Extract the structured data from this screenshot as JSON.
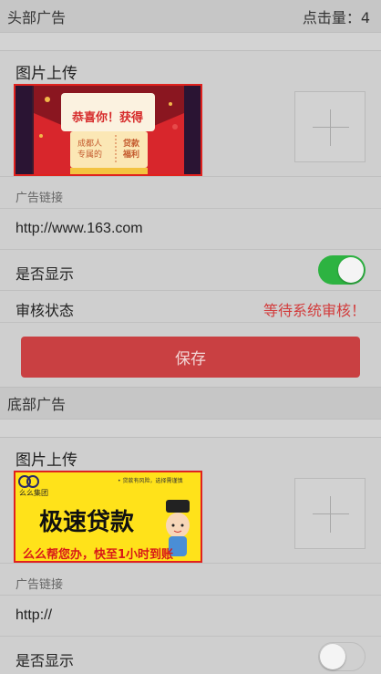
{
  "top_section": {
    "title": "头部广告",
    "clicks_label": "点击量：4",
    "upload_title": "图片上传",
    "image": {
      "headline": "恭喜你！获得",
      "left_text": "成都人\n专属的",
      "right_text": "贷款\n福利"
    },
    "link_label": "广告链接",
    "link_value": "http://www.163.com",
    "show_label": "是否显示",
    "show_enabled": true,
    "review_label": "审核状态",
    "review_status": "等待系统审核！",
    "save_label": "保存"
  },
  "bottom_section": {
    "title": "底部广告",
    "upload_title": "图片上传",
    "image": {
      "brand": "么么集团",
      "slogan": "• 贷款有风险，选择需谨慎",
      "headline": "极速贷款",
      "tagline": "么么帮您办，快至1小时到账"
    },
    "link_label": "广告链接",
    "link_value": "http://",
    "show_label": "是否显示",
    "show_enabled": false
  },
  "colors": {
    "accent_red": "#c94042",
    "toggle_on": "#2db341",
    "status_red": "#d23c3c"
  }
}
